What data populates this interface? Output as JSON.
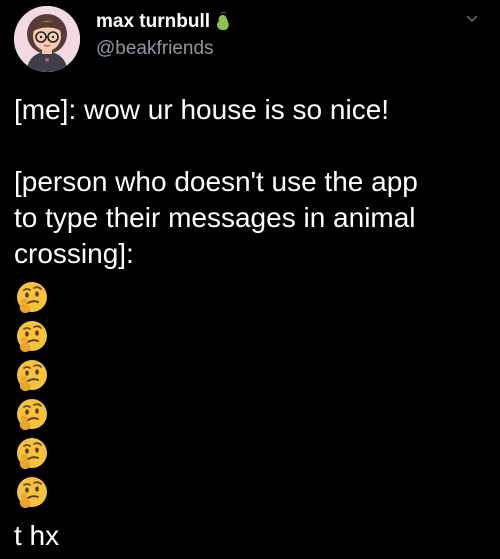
{
  "author": {
    "display_name": "max turnbull",
    "handle": "@beakfriends",
    "avatar_icon": "avatar-girl-with-glasses",
    "badge_icon": "pear-icon"
  },
  "tweet": {
    "line1": "[me]: wow ur house is so nice!",
    "line2": "[person who doesn't use the app",
    "line3": "to type their messages in animal",
    "line4": "crossing]:",
    "emoji": "thinking-face",
    "emoji_count": 6,
    "closing": "t hx"
  },
  "colors": {
    "background": "#000000",
    "text": "#ffffff",
    "handle": "#8b98a5"
  }
}
